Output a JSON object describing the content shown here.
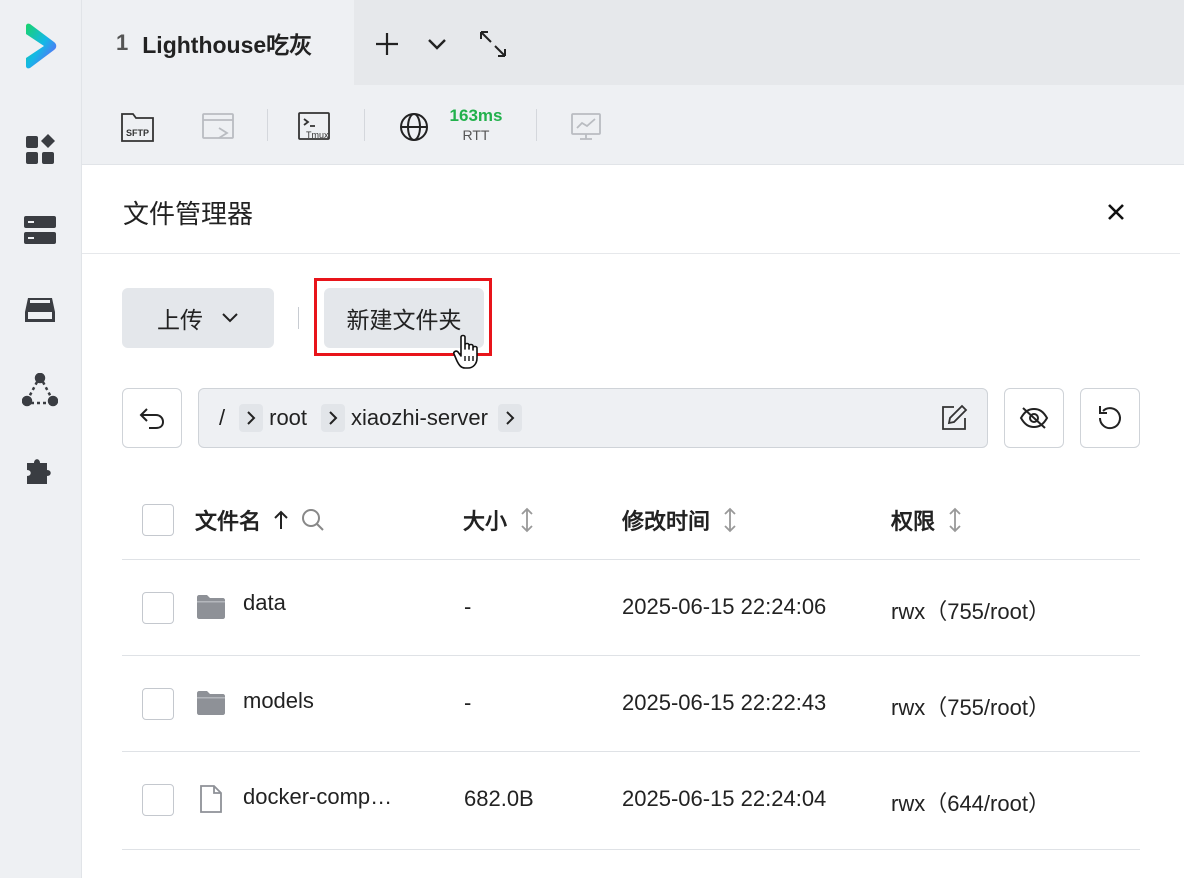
{
  "tab": {
    "number": "1",
    "title": "Lighthouse吃灰"
  },
  "toolbar": {
    "rtt_value": "163ms",
    "rtt_label": "RTT"
  },
  "panel": {
    "title": "文件管理器",
    "upload_label": "上传",
    "new_folder_label": "新建文件夹"
  },
  "breadcrumb": {
    "root": "/",
    "items": [
      "root",
      "xiaozhi-server"
    ]
  },
  "table": {
    "columns": {
      "name": "文件名",
      "size": "大小",
      "modified": "修改时间",
      "perm": "权限"
    },
    "rows": [
      {
        "type": "folder",
        "name": "data",
        "size": "-",
        "modified": "2025-06-15 22:24:06",
        "perm": "rwx（755/root）"
      },
      {
        "type": "folder",
        "name": "models",
        "size": "-",
        "modified": "2025-06-15 22:22:43",
        "perm": "rwx（755/root）"
      },
      {
        "type": "file",
        "name": "docker-comp…",
        "size": "682.0B",
        "modified": "2025-06-15 22:24:04",
        "perm": "rwx（644/root）"
      }
    ]
  },
  "colors": {
    "accent_green": "#22b14c",
    "highlight_red": "#e8141a",
    "button_bg": "#e4e7eb"
  }
}
